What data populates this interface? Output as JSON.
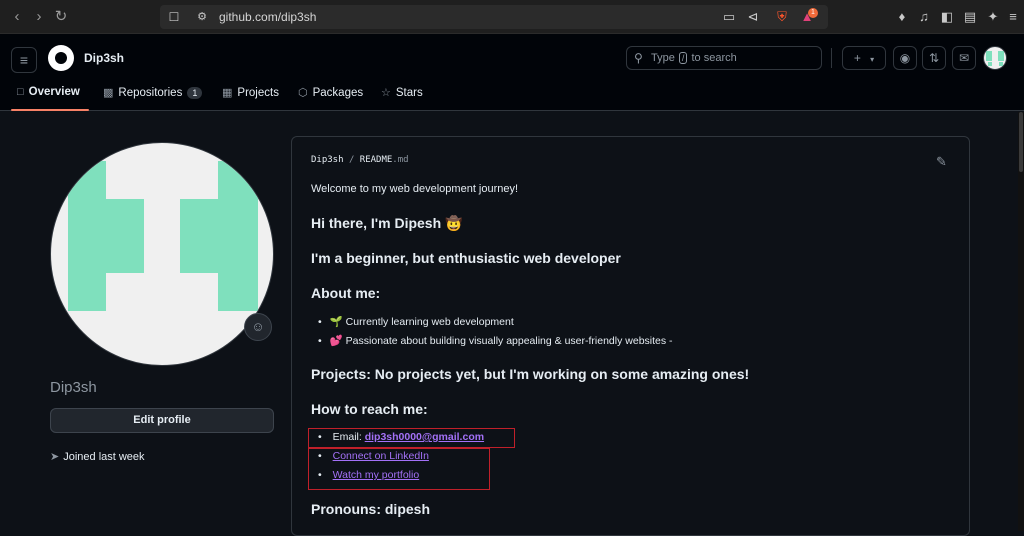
{
  "browser": {
    "url": "github.com/dip3sh",
    "brave_badge": "1"
  },
  "header": {
    "username": "Dip3sh",
    "search": {
      "prefix": "Type",
      "key": "/",
      "suffix": "to search"
    },
    "new_button": "+",
    "new_caret": "▾"
  },
  "tabs": [
    {
      "label": "Overview",
      "icon": "book-icon"
    },
    {
      "label": "Repositories",
      "icon": "repo-icon",
      "count": "1"
    },
    {
      "label": "Projects",
      "icon": "table-icon"
    },
    {
      "label": "Packages",
      "icon": "package-icon"
    },
    {
      "label": "Stars",
      "icon": "star-icon"
    }
  ],
  "profile": {
    "name": "Dip3sh",
    "edit_label": "Edit profile",
    "joined": "Joined last week"
  },
  "readme": {
    "owner": "Dip3sh",
    "separator": "/",
    "file_name": "README",
    "file_ext": ".md",
    "intro": "Welcome to my web development journey!",
    "heading_hi": "Hi there, I'm Dipesh 🤠",
    "heading_beginner": "I'm a beginner, but enthusiastic web developer",
    "heading_about": "About me:",
    "about_items": [
      "🌱 Currently learning web development",
      "💕 Passionate about building visually appealing & user-friendly websites -"
    ],
    "heading_projects": "Projects: No projects yet, but I'm working on some amazing ones!",
    "heading_reach": "How to reach me:",
    "email_label": "Email: ",
    "email": "dip3sh0000@gmail.com",
    "linkedin": "Connect on LinkedIn",
    "portfolio": "Watch my portfolio",
    "heading_pronouns": "Pronouns: dipesh"
  },
  "colors": {
    "accent_tab": "#f78166",
    "link": "#a371f7",
    "avatar_green": "#7fe0bd",
    "annotation_red": "#c0202a"
  }
}
